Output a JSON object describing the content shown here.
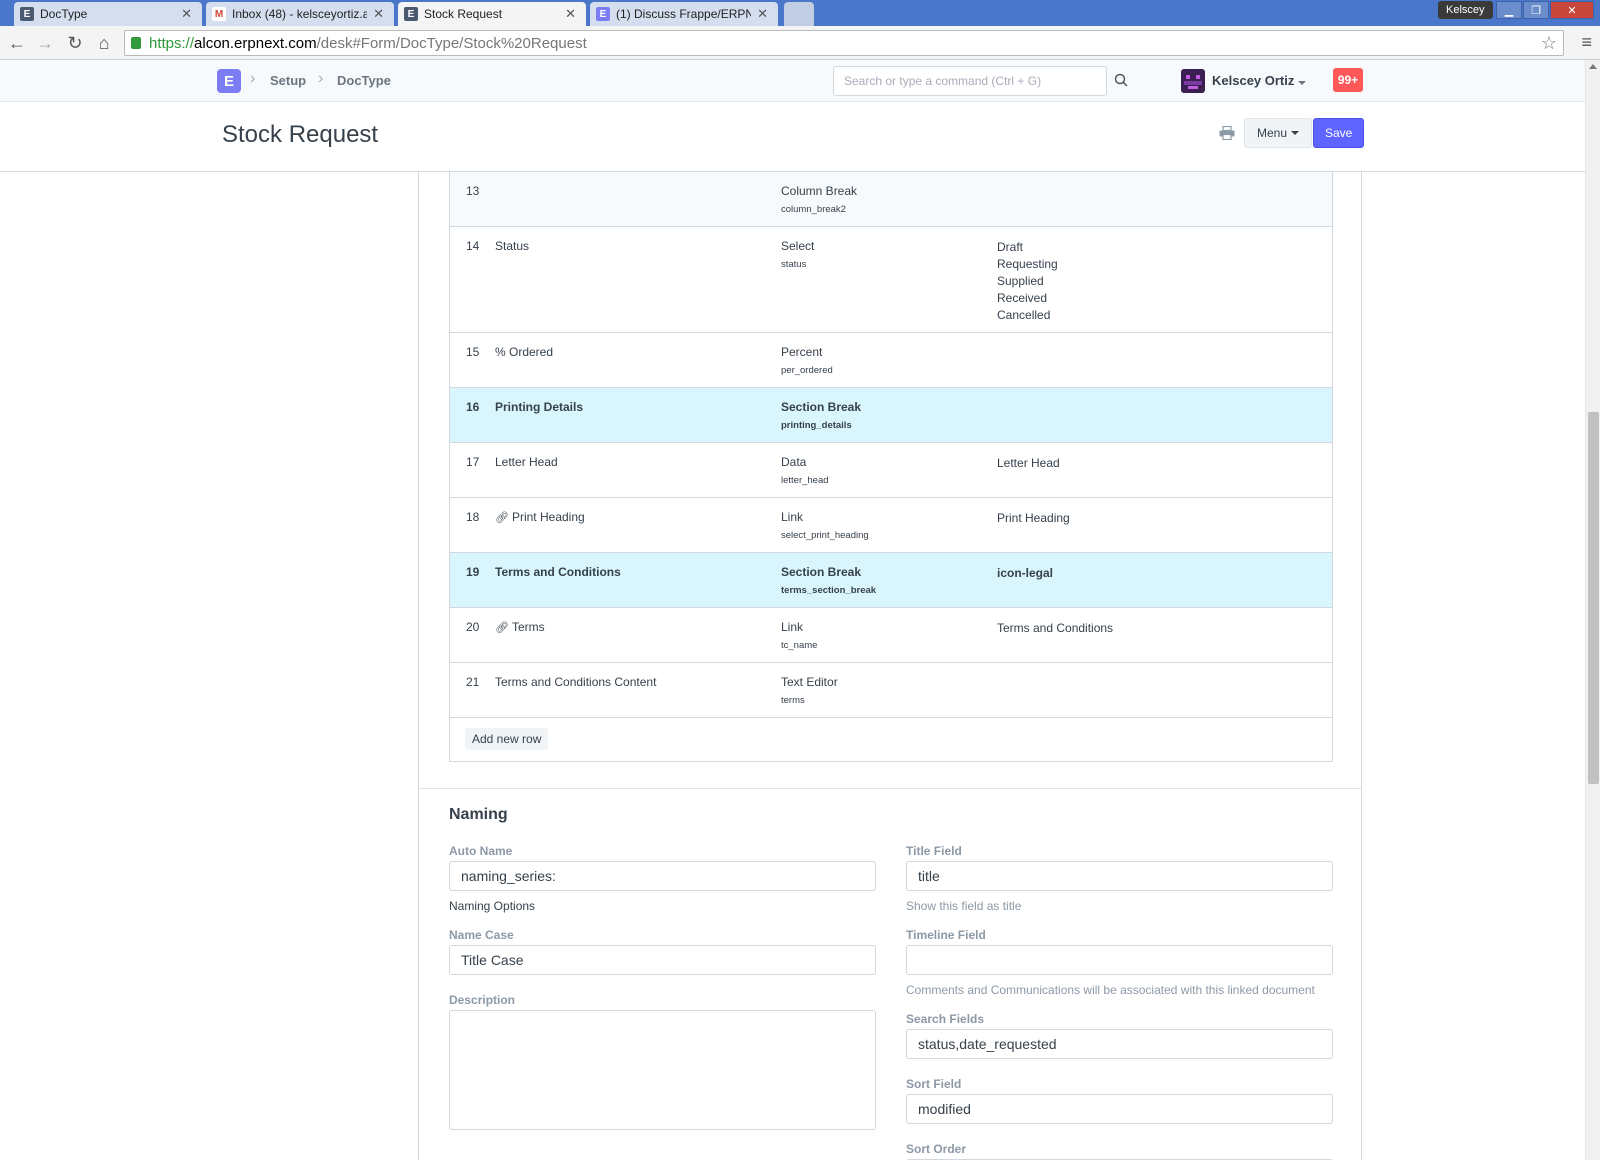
{
  "browser": {
    "tabs": [
      {
        "title": "DocType",
        "fav": "E",
        "fav_color": "#4a5a70"
      },
      {
        "title": "Inbox (48) - kelsceyortiz.al",
        "fav": "M",
        "fav_color": "#d14836"
      },
      {
        "title": "Stock Request",
        "fav": "E",
        "fav_color": "#4a5a70"
      },
      {
        "title": "(1) Discuss Frappe/ERPNe",
        "fav": "E",
        "fav_color": "#7c7cf5"
      }
    ],
    "window_user": "Kelscey",
    "url": {
      "scheme": "https://",
      "host": "alcon.erpnext.com",
      "path": "/desk#Form/DocType/Stock%20Request"
    }
  },
  "navbar": {
    "logo": "E",
    "breadcrumbs": [
      "Setup",
      "DocType"
    ],
    "search_placeholder": "Search or type a command (Ctrl + G)",
    "user_name": "Kelscey Ortiz",
    "notifications": "99+"
  },
  "page": {
    "title": "Stock Request",
    "menu_label": "Menu",
    "save_label": "Save"
  },
  "fields_grid": {
    "rows": [
      {
        "idx": "13",
        "label": "",
        "type": "Column Break",
        "fieldname": "column_break2",
        "options": [],
        "style": "alt"
      },
      {
        "idx": "14",
        "label": "Status",
        "type": "Select",
        "fieldname": "status",
        "options": [
          "Draft",
          "Requesting",
          "Supplied",
          "Received",
          "Cancelled"
        ],
        "style": "tall"
      },
      {
        "idx": "15",
        "label": "% Ordered",
        "type": "Percent",
        "fieldname": "per_ordered",
        "options": [],
        "style": ""
      },
      {
        "idx": "16",
        "label": "Printing Details",
        "type": "Section Break",
        "fieldname": "printing_details",
        "options": [],
        "style": "section"
      },
      {
        "idx": "17",
        "label": "Letter Head",
        "type": "Data",
        "fieldname": "letter_head",
        "options": [
          "Letter Head"
        ],
        "style": ""
      },
      {
        "idx": "18",
        "label": "Print Heading",
        "link": true,
        "type": "Link",
        "fieldname": "select_print_heading",
        "options": [
          "Print Heading"
        ],
        "style": ""
      },
      {
        "idx": "19",
        "label": "Terms and Conditions",
        "type": "Section Break",
        "fieldname": "terms_section_break",
        "options": [
          "icon-legal"
        ],
        "style": "section"
      },
      {
        "idx": "20",
        "label": "Terms",
        "link": true,
        "type": "Link",
        "fieldname": "tc_name",
        "options": [
          "Terms and Conditions"
        ],
        "style": ""
      },
      {
        "idx": "21",
        "label": "Terms and Conditions Content",
        "type": "Text Editor",
        "fieldname": "terms",
        "options": [],
        "style": ""
      }
    ],
    "add_row_label": "Add new row"
  },
  "naming": {
    "section_title": "Naming",
    "auto_name": {
      "label": "Auto Name",
      "value": "naming_series:",
      "description": "Naming Options"
    },
    "name_case": {
      "label": "Name Case",
      "value": "Title Case"
    },
    "description": {
      "label": "Description",
      "value": ""
    },
    "title_field": {
      "label": "Title Field",
      "value": "title",
      "description": "Show this field as title"
    },
    "timeline_field": {
      "label": "Timeline Field",
      "value": "",
      "description": "Comments and Communications will be associated with this linked document"
    },
    "search_fields": {
      "label": "Search Fields",
      "value": "status,date_requested"
    },
    "sort_field": {
      "label": "Sort Field",
      "value": "modified"
    },
    "sort_order": {
      "label": "Sort Order"
    }
  },
  "icons": [
    "back-arrow-icon",
    "forward-arrow-icon",
    "reload-icon",
    "home-icon",
    "lock-icon",
    "star-icon",
    "chrome-menu-icon",
    "search-icon",
    "print-icon",
    "link-icon",
    "caret-down-icon"
  ]
}
